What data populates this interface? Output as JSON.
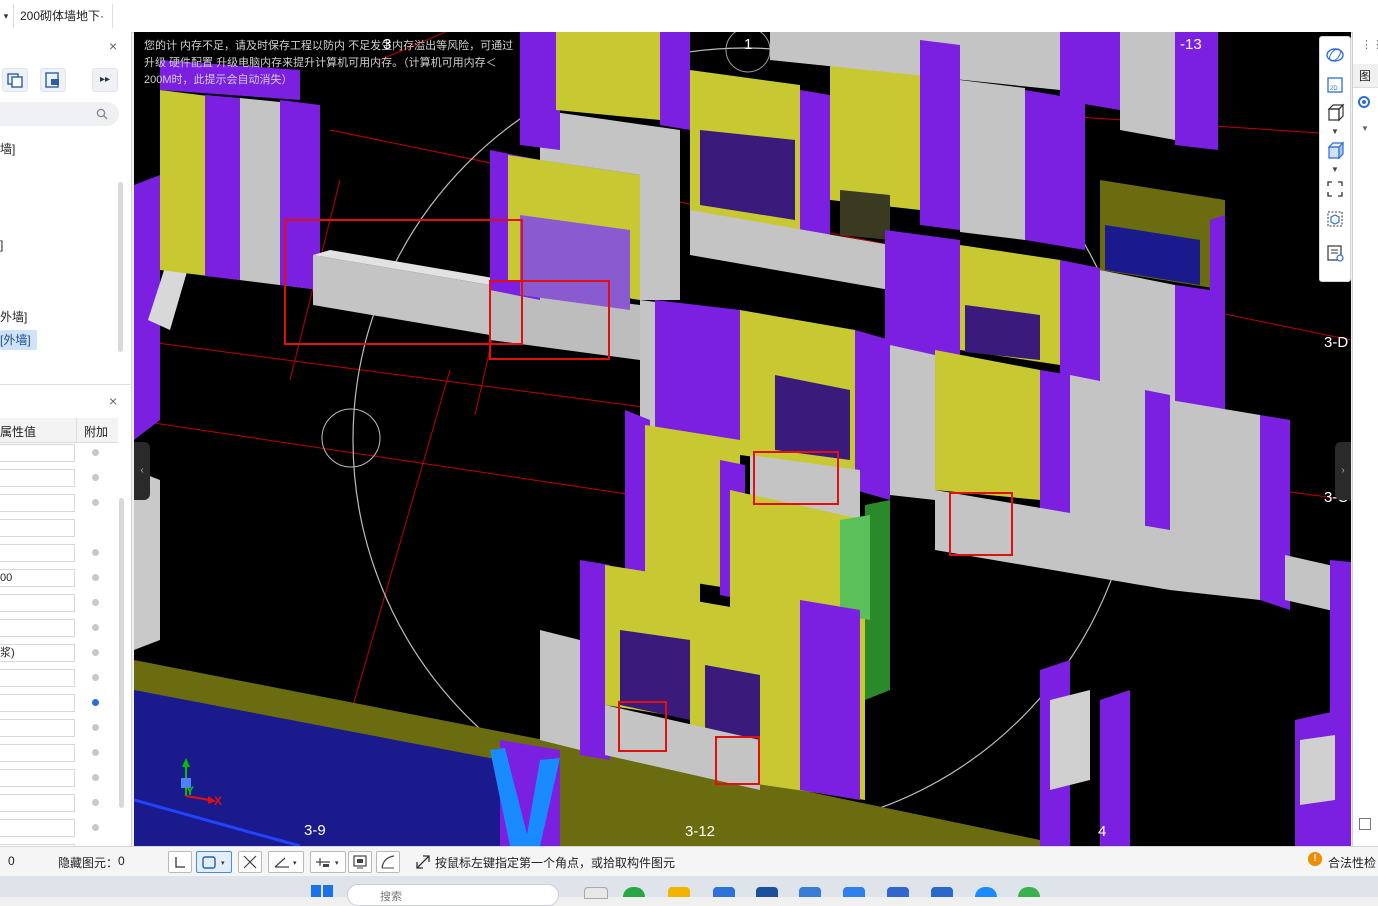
{
  "topbar": {
    "dropdown_arrow": "▾",
    "layer_select": "200砌体墙地下·",
    "layer_select_arrow": "▾"
  },
  "left_panel": {
    "close_icon": "×",
    "expand_label": "▸▸",
    "tree_items": [
      "墙]",
      "]",
      "外墙]",
      "[外墙]"
    ],
    "properties": {
      "close_icon": "×",
      "col_value": "属性值",
      "col_extra": "附加",
      "rows": [
        "",
        "",
        "",
        "",
        "",
        "00",
        "",
        "",
        "浆)",
        "",
        "",
        "",
        "",
        "",
        "",
        "",
        ""
      ],
      "dot_states": [
        false,
        false,
        false,
        null,
        false,
        false,
        false,
        false,
        false,
        false,
        true,
        false,
        false,
        false,
        false,
        false,
        false
      ]
    }
  },
  "canvas": {
    "memory_warning": "您的计 内存不足，请及时保存工程以防内 不足发生内存溢出等风险，可通过升级 硬件配置 升级电脑内存来提升计算机可用内存。（计算机可用内存＜200M时，此提示会自动消失）",
    "axis_labels": [
      "1",
      "-13",
      "3-D",
      "3-C",
      "3-9",
      "3-12",
      "4",
      "3"
    ],
    "coord_x": "X",
    "coord_y": "Y",
    "colors": {
      "background": "#000000",
      "purple_column": "#7b1fe0",
      "yellow_wall": "#c8c832",
      "grey_wall": "#c4c4c4",
      "highlight_box": "#e01010",
      "axis_line": "#d00000"
    }
  },
  "status_bar": {
    "count_label": "0",
    "hidden_label": "隐藏图元：",
    "hidden_count": "0",
    "prompt": "按鼠标左键指定第一个角点，或拾取构件图元",
    "validity_label": "合法性检"
  },
  "right_panel": {
    "tab_label": "图"
  },
  "taskbar": {
    "search_placeholder": "搜索"
  }
}
